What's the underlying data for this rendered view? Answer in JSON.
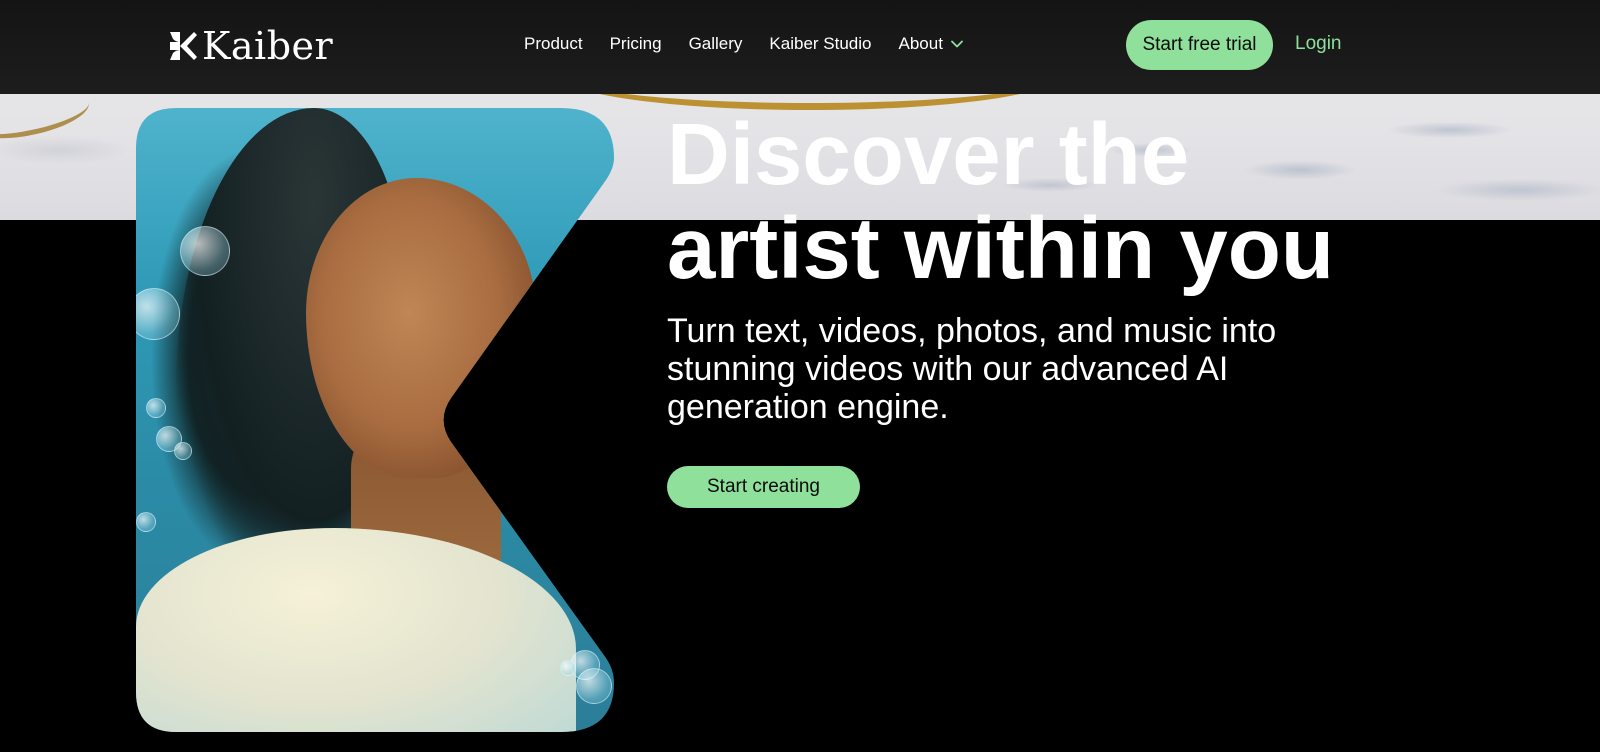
{
  "brand": {
    "name": "Kaiber",
    "accent_color": "#8fe09b",
    "logo_icon": "kaiber-logo-icon"
  },
  "nav": {
    "items": [
      {
        "label": "Product"
      },
      {
        "label": "Pricing"
      },
      {
        "label": "Gallery"
      },
      {
        "label": "Kaiber Studio"
      },
      {
        "label": "About",
        "icon": "chevron-down-icon"
      }
    ],
    "cta_label": "Start free trial",
    "login_label": "Login"
  },
  "hero": {
    "headline_line1": "Discover the",
    "headline_line2": "artist within you",
    "subtext": "Turn text, videos, photos, and music into stunning videos with our advanced AI generation engine.",
    "cta_label": "Start creating",
    "image_description_icon": "portrait-image"
  }
}
